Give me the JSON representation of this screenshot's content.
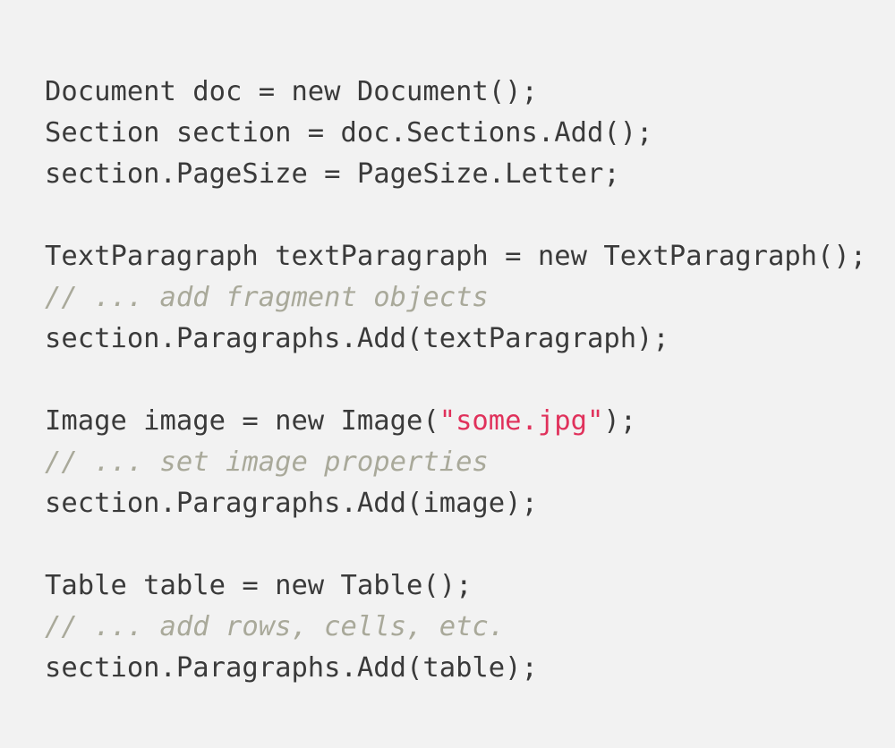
{
  "page": {
    "kind": "code-snippet",
    "language": "csharp",
    "background_color": "#f2f2f2"
  },
  "theme": {
    "plain_color": "#3a3a3a",
    "comment_color": "#a9a99a",
    "string_color": "#e0315b",
    "background_color": "#f2f2f2"
  },
  "code": {
    "lines": [
      {
        "index": 0,
        "text": "Document doc = new Document();",
        "tokens": [
          {
            "type": "plain",
            "text": "Document doc = new Document();"
          }
        ]
      },
      {
        "index": 1,
        "text": "Section section = doc.Sections.Add();",
        "tokens": [
          {
            "type": "plain",
            "text": "Section section = doc.Sections.Add();"
          }
        ]
      },
      {
        "index": 2,
        "text": "section.PageSize = PageSize.Letter;",
        "tokens": [
          {
            "type": "plain",
            "text": "section.PageSize = PageSize.Letter;"
          }
        ]
      },
      {
        "index": 3,
        "text": "",
        "tokens": []
      },
      {
        "index": 4,
        "text": "TextParagraph textParagraph = new TextParagraph();",
        "tokens": [
          {
            "type": "plain",
            "text": "TextParagraph textParagraph = new TextParagraph();"
          }
        ]
      },
      {
        "index": 5,
        "text": "// ... add fragment objects",
        "tokens": [
          {
            "type": "comment",
            "text": "// ... add fragment objects"
          }
        ]
      },
      {
        "index": 6,
        "text": "section.Paragraphs.Add(textParagraph);",
        "tokens": [
          {
            "type": "plain",
            "text": "section.Paragraphs.Add(textParagraph);"
          }
        ]
      },
      {
        "index": 7,
        "text": "",
        "tokens": []
      },
      {
        "index": 8,
        "text": "Image image = new Image(\"some.jpg\");",
        "tokens": [
          {
            "type": "plain",
            "text": "Image image = new Image("
          },
          {
            "type": "string",
            "text": "\"some.jpg\""
          },
          {
            "type": "plain",
            "text": ");"
          }
        ]
      },
      {
        "index": 9,
        "text": "// ... set image properties",
        "tokens": [
          {
            "type": "comment",
            "text": "// ... set image properties"
          }
        ]
      },
      {
        "index": 10,
        "text": "section.Paragraphs.Add(image);",
        "tokens": [
          {
            "type": "plain",
            "text": "section.Paragraphs.Add(image);"
          }
        ]
      },
      {
        "index": 11,
        "text": "",
        "tokens": []
      },
      {
        "index": 12,
        "text": "Table table = new Table();",
        "tokens": [
          {
            "type": "plain",
            "text": "Table table = new Table();"
          }
        ]
      },
      {
        "index": 13,
        "text": "// ... add rows, cells, etc.",
        "tokens": [
          {
            "type": "comment",
            "text": "// ... add rows, cells, etc."
          }
        ]
      },
      {
        "index": 14,
        "text": "section.Paragraphs.Add(table);",
        "tokens": [
          {
            "type": "plain",
            "text": "section.Paragraphs.Add(table);"
          }
        ]
      }
    ]
  }
}
